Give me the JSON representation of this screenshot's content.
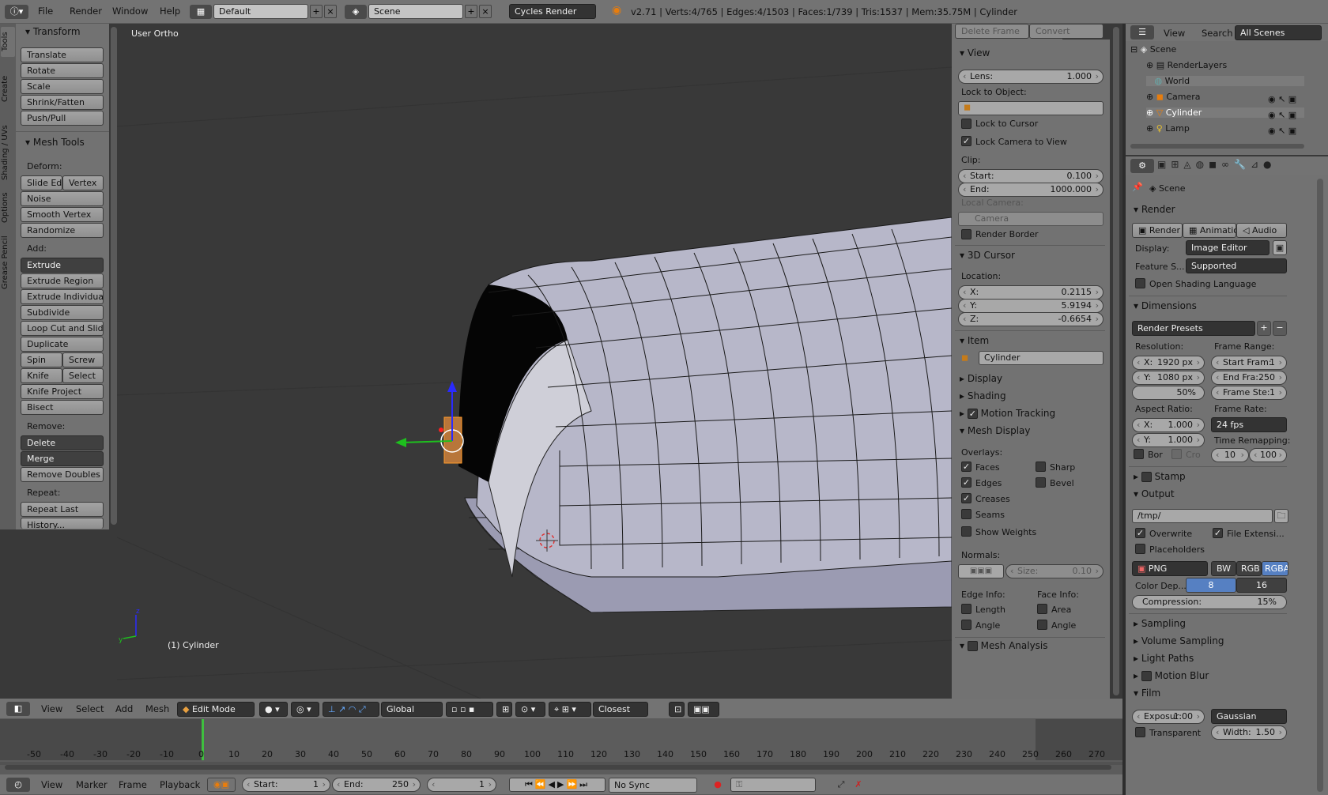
{
  "topbar": {
    "menus": [
      "File",
      "Render",
      "Window",
      "Help"
    ],
    "layout": "Default",
    "scene": "Scene",
    "engine": "Cycles Render",
    "stats": "v2.71 | Verts:4/765 | Edges:4/1503 | Faces:1/739 | Tris:1537 | Mem:35.75M | Cylinder"
  },
  "toolshelf": {
    "tabs": [
      "Tools",
      "Create",
      "Shading / UVs",
      "Options",
      "Grease Pencil"
    ],
    "transform_title": "Transform",
    "transform": [
      "Translate",
      "Rotate",
      "Scale",
      "Shrink/Fatten",
      "Push/Pull"
    ],
    "meshtools_title": "Mesh Tools",
    "deform_label": "Deform:",
    "slide_edge": "Slide Ed",
    "vertex": "Vertex",
    "noise": "Noise",
    "smooth_vertex": "Smooth Vertex",
    "randomize": "Randomize",
    "add_label": "Add:",
    "extrude": "Extrude",
    "extrude_region": "Extrude Region",
    "extrude_individual": "Extrude Individual",
    "subdivide": "Subdivide",
    "loop_cut": "Loop Cut and Slide",
    "duplicate": "Duplicate",
    "spin": "Spin",
    "screw": "Screw",
    "knife": "Knife",
    "select": "Select",
    "knife_project": "Knife Project",
    "bisect": "Bisect",
    "remove_label": "Remove:",
    "delete": "Delete",
    "merge": "Merge",
    "remove_doubles": "Remove Doubles",
    "repeat_label": "Repeat:",
    "repeat_last": "Repeat Last",
    "history": "History..."
  },
  "viewport": {
    "view_name": "User Ortho",
    "object_name": "(1) Cylinder"
  },
  "npanel": {
    "delete_frame": "Delete Frame",
    "convert": "Convert",
    "view_title": "View",
    "lens_label": "Lens:",
    "lens_value": "1.000",
    "lock_to_object": "Lock to Object:",
    "lock_to_cursor": "Lock to Cursor",
    "lock_camera": "Lock Camera to View",
    "clip_label": "Clip:",
    "start_label": "Start:",
    "start_value": "0.100",
    "end_label": "End:",
    "end_value": "1000.000",
    "local_camera": "Local Camera:",
    "camera": "Camera",
    "render_border": "Render Border",
    "cursor_title": "3D Cursor",
    "location_label": "Location:",
    "x_label": "X:",
    "x_value": "0.2115",
    "y_label": "Y:",
    "y_value": "5.9194",
    "z_label": "Z:",
    "z_value": "-0.6654",
    "item_title": "Item",
    "item_name": "Cylinder",
    "display": "Display",
    "shading": "Shading",
    "motion_tracking": "Motion Tracking",
    "mesh_display": "Mesh Display",
    "overlays_label": "Overlays:",
    "faces": "Faces",
    "sharp": "Sharp",
    "edges": "Edges",
    "bevel": "Bevel",
    "creases": "Creases",
    "seams": "Seams",
    "show_weights": "Show Weights",
    "normals_label": "Normals:",
    "size_label": "Size:",
    "size_value": "0.10",
    "edge_info": "Edge Info:",
    "face_info": "Face Info:",
    "length": "Length",
    "area": "Area",
    "angle": "Angle",
    "angle2": "Angle",
    "mesh_analysis": "Mesh Analysis"
  },
  "vp_header": {
    "menus": [
      "View",
      "Select",
      "Add",
      "Mesh"
    ],
    "mode": "Edit Mode",
    "orientation": "Global",
    "snap": "Closest"
  },
  "timeline": {
    "ticks": [
      "-50",
      "-40",
      "-30",
      "-20",
      "-10",
      "0",
      "10",
      "20",
      "30",
      "40",
      "50",
      "60",
      "70",
      "80",
      "90",
      "100",
      "110",
      "120",
      "130",
      "140",
      "150",
      "160",
      "170",
      "180",
      "190",
      "200",
      "210",
      "220",
      "230",
      "240",
      "250",
      "260",
      "270"
    ],
    "menus": [
      "View",
      "Marker",
      "Frame",
      "Playback"
    ],
    "start_label": "Start:",
    "start_value": "1",
    "end_label": "End:",
    "end_value": "250",
    "current": "1",
    "sync": "No Sync"
  },
  "outliner": {
    "menus": [
      "View",
      "Search"
    ],
    "filter": "All Scenes",
    "items": [
      "Scene",
      "RenderLayers",
      "World",
      "Camera",
      "Cylinder",
      "Lamp"
    ]
  },
  "properties": {
    "context": "Scene",
    "render_title": "Render",
    "render_btn": "Render",
    "anim_btn": "Animatio",
    "audio_btn": "Audio",
    "display_label": "Display:",
    "display_value": "Image Editor",
    "feature_label": "Feature S...",
    "feature_value": "Supported",
    "osl": "Open Shading Language",
    "dimensions_title": "Dimensions",
    "presets": "Render Presets",
    "resolution_label": "Resolution:",
    "frame_range_label": "Frame Range:",
    "res_x_label": "X:",
    "res_x": "1920 px",
    "res_y_label": "Y:",
    "res_y": "1080 px",
    "res_pct": "50%",
    "start_frame_label": "Start Fram:",
    "start_frame": "1",
    "end_frame_label": "End Fra:",
    "end_frame": "250",
    "frame_step_label": "Frame Ste:",
    "frame_step": "1",
    "aspect_label": "Aspect Ratio:",
    "frame_rate_label": "Frame Rate:",
    "asp_x_label": "X:",
    "asp_x": "1.000",
    "asp_y_label": "Y:",
    "asp_y": "1.000",
    "fps": "24 fps",
    "time_remap_label": "Time Remapping:",
    "bor": "Bor",
    "cro": "Cro",
    "remap_old": "10",
    "remap_new": "100",
    "stamp": "Stamp",
    "output_title": "Output",
    "output_path": "/tmp/",
    "overwrite": "Overwrite",
    "file_ext": "File Extensi...",
    "placeholders": "Placeholders",
    "format": "PNG",
    "bw": "BW",
    "rgb": "RGB",
    "rgba": "RGBA",
    "color_depth_label": "Color Dep...",
    "depth8": "8",
    "depth16": "16",
    "compression_label": "Compression:",
    "compression": "15%",
    "sampling": "Sampling",
    "volume_sampling": "Volume Sampling",
    "light_paths": "Light Paths",
    "motion_blur": "Motion Blur",
    "film_title": "Film",
    "exposure_label": "Exposur:",
    "exposure": "1.00",
    "filter": "Gaussian",
    "transparent": "Transparent",
    "width_label": "Width:",
    "width": "1.50"
  }
}
